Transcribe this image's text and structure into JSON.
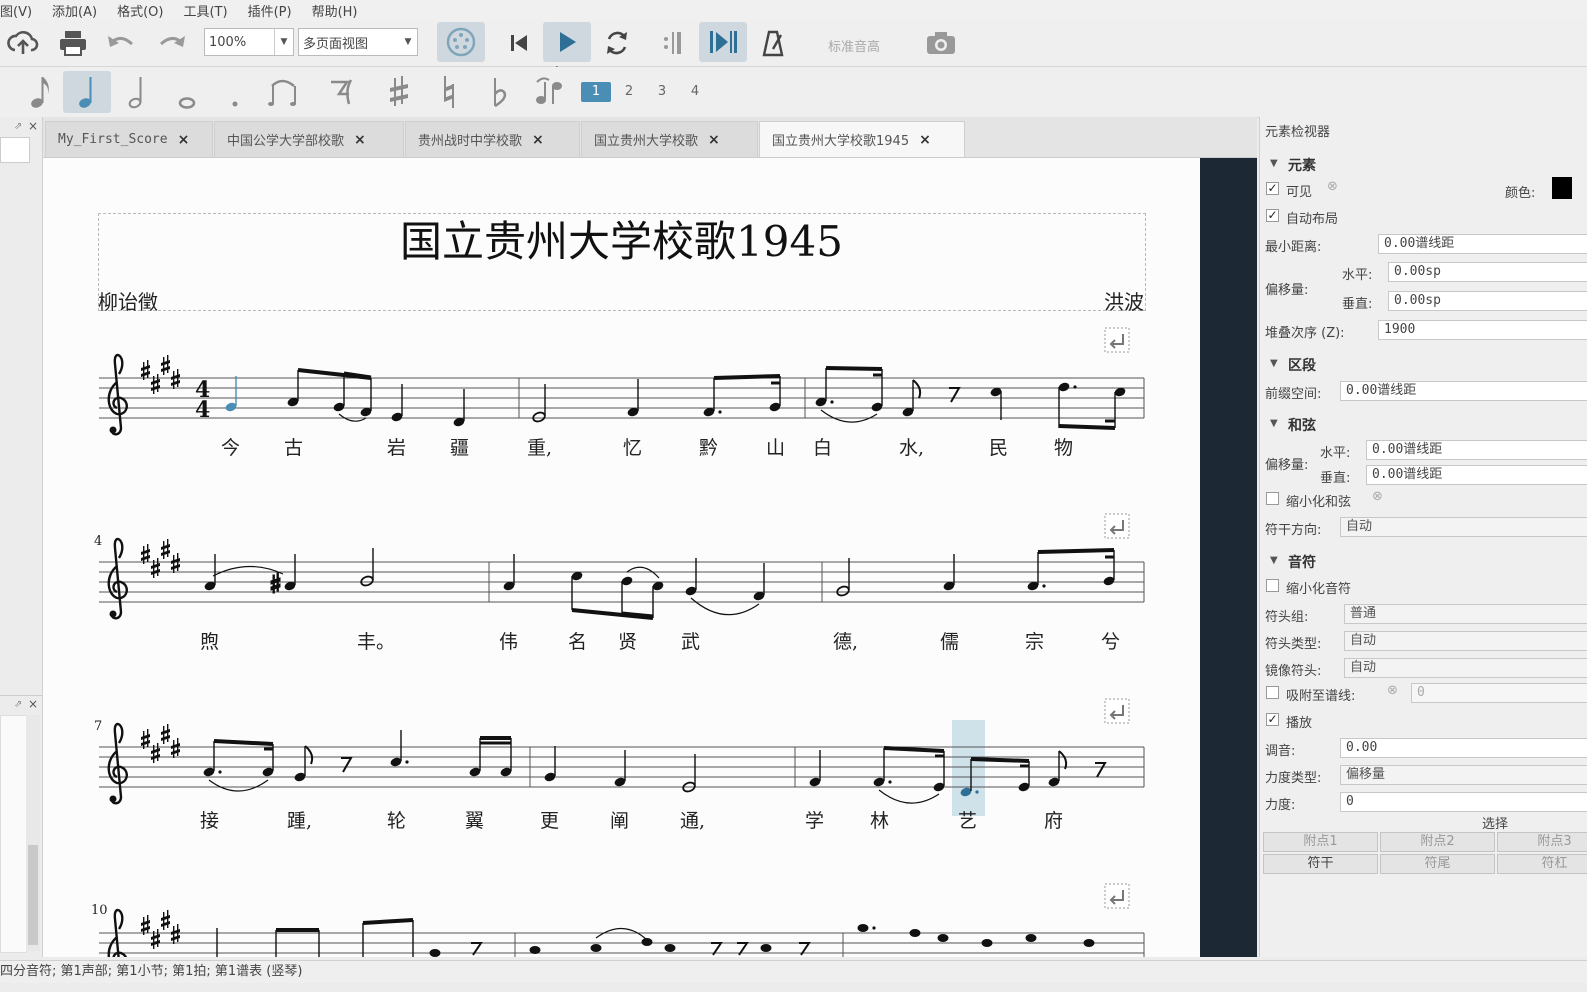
{
  "menu": [
    "图(V)",
    "添加(A)",
    "格式(O)",
    "工具(T)",
    "插件(P)",
    "帮助(H)"
  ],
  "toolbar": {
    "zoom_value": "100%",
    "view_mode": "多页面视图",
    "concert_pitch": "标准音高"
  },
  "note_toolbar": {
    "voices": [
      "1",
      "2",
      "3",
      "4"
    ]
  },
  "tabs": [
    {
      "label": "My_First_Score"
    },
    {
      "label": "中国公学大学部校歌"
    },
    {
      "label": "贵州战时中学校歌"
    },
    {
      "label": "国立贵州大学校歌"
    },
    {
      "label": "国立贵州大学校歌1945"
    }
  ],
  "score": {
    "title": "国立贵州大学校歌1945",
    "lyricist": "柳诒徵",
    "composer": "洪波",
    "time_signature_top": "4",
    "time_signature_bottom": "4",
    "measure_numbers": [
      "4",
      "7",
      "10"
    ],
    "lyrics_row1": [
      "今",
      "古",
      "岩",
      "疆",
      "重,",
      "忆",
      "黔",
      "山",
      "白",
      "水,",
      "民",
      "物"
    ],
    "lyrics_row2": [
      "煦",
      "丰。",
      "伟",
      "名",
      "贤",
      "武",
      "德,",
      "儒",
      "宗",
      "兮"
    ],
    "lyrics_row3": [
      "接",
      "踵,",
      "轮",
      "翼",
      "更",
      "阐",
      "通,",
      "学",
      "林",
      "艺",
      "府"
    ]
  },
  "inspector": {
    "title": "元素检视器",
    "element_section": "元素",
    "visible_label": "可见",
    "color_label": "颜色:",
    "auto_layout_label": "自动布局",
    "min_distance_label": "最小距离:",
    "min_distance_value": "0.00谱线距",
    "offset_label": "偏移量:",
    "horizontal_label": "水平:",
    "horizontal_value": "0.00sp",
    "vertical_label": "垂直:",
    "vertical_value": "0.00sp",
    "stacking_label": "堆叠次序 (Z):",
    "stacking_value": "1900",
    "segment_section": "区段",
    "leading_space_label": "前缀空间:",
    "leading_space_value": "0.00谱线距",
    "chord_section": "和弦",
    "chord_offset_label": "偏移量:",
    "chord_h_label": "水平:",
    "chord_h_value": "0.00谱线距",
    "chord_v_label": "垂直:",
    "chord_v_value": "0.00谱线距",
    "small_chord_label": "缩小化和弦",
    "stem_direction_label": "符干方向:",
    "stem_direction_value": "自动",
    "note_section": "音符",
    "small_note_label": "缩小化音符",
    "head_group_label": "符头组:",
    "head_group_value": "普通",
    "head_type_label": "符头类型:",
    "head_type_value": "自动",
    "mirror_head_label": "镜像符头:",
    "mirror_head_value": "自动",
    "snap_label": "吸附至谱线:",
    "snap_value": "0",
    "play_label": "播放",
    "tuning_label": "调音:",
    "tuning_value": "0.00",
    "velocity_type_label": "力度类型:",
    "velocity_type_value": "偏移量",
    "velocity_label": "力度:",
    "velocity_value": "0",
    "select_label": "选择",
    "buttons_row1": [
      "附点1",
      "附点2",
      "附点3"
    ],
    "buttons_row2": [
      "符干",
      "符尾",
      "符杠"
    ]
  },
  "status_bar": "四分音符;  第1声部;   第1小节; 第1拍; 第1谱表 (竖琴)"
}
